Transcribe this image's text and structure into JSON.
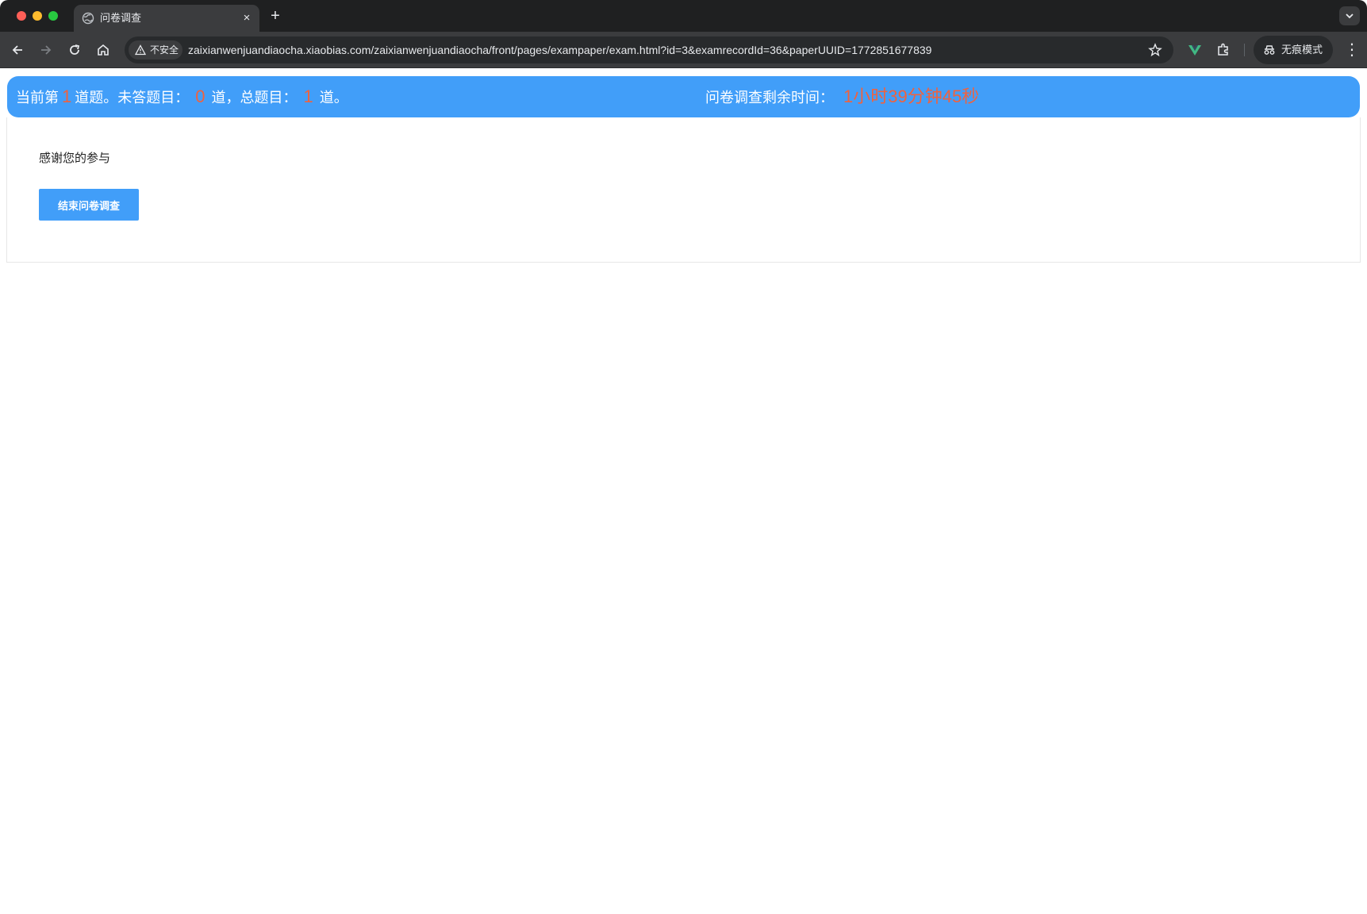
{
  "browser": {
    "tab_title": "问卷调查",
    "new_tab_symbol": "+",
    "close_symbol": "×",
    "security_chip_label": "不安全",
    "url": "zaixianwenjuandiaocha.xiaobias.com/zaixianwenjuandiaocha/front/pages/exampaper/exam.html?id=3&examrecordId=36&paperUUID=1772851677839",
    "incognito_label": "无痕模式",
    "menu_symbol": "⋮"
  },
  "status": {
    "prefix": "当前第",
    "current_number": "1",
    "mid1": "道题。未答题目：",
    "unanswered": "0",
    "mid2": "道，总题目：",
    "total": "1",
    "suffix": "道。",
    "timer_label": "问卷调查剩余时间：",
    "timer_value": "1小时39分钟45秒"
  },
  "content": {
    "thanks_text": "感谢您的参与",
    "finish_button_label": "结束问卷调查"
  },
  "colors": {
    "accent": "#419ef9",
    "highlight": "#f0623e"
  }
}
